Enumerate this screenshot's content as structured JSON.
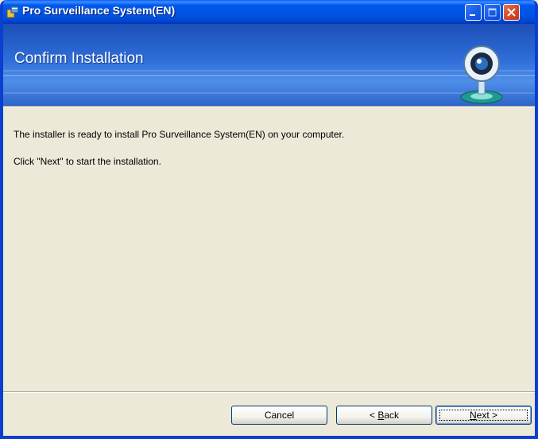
{
  "window": {
    "title": "Pro Surveillance System(EN)",
    "icon": "installer-icon"
  },
  "banner": {
    "title": "Confirm Installation",
    "icon": "webcam-icon"
  },
  "content": {
    "line1": "The installer is ready to install Pro Surveillance System(EN) on your computer.",
    "line2": "Click \"Next\" to start the installation."
  },
  "buttons": {
    "cancel": "Cancel",
    "back_prefix": "< ",
    "back_mnemonic": "B",
    "back_rest": "ack",
    "next_mnemonic": "N",
    "next_rest": "ext >"
  },
  "colors": {
    "titlebar": "#0058EE",
    "dialog_bg": "#ECE9D8",
    "banner": "#2F6ED9"
  }
}
